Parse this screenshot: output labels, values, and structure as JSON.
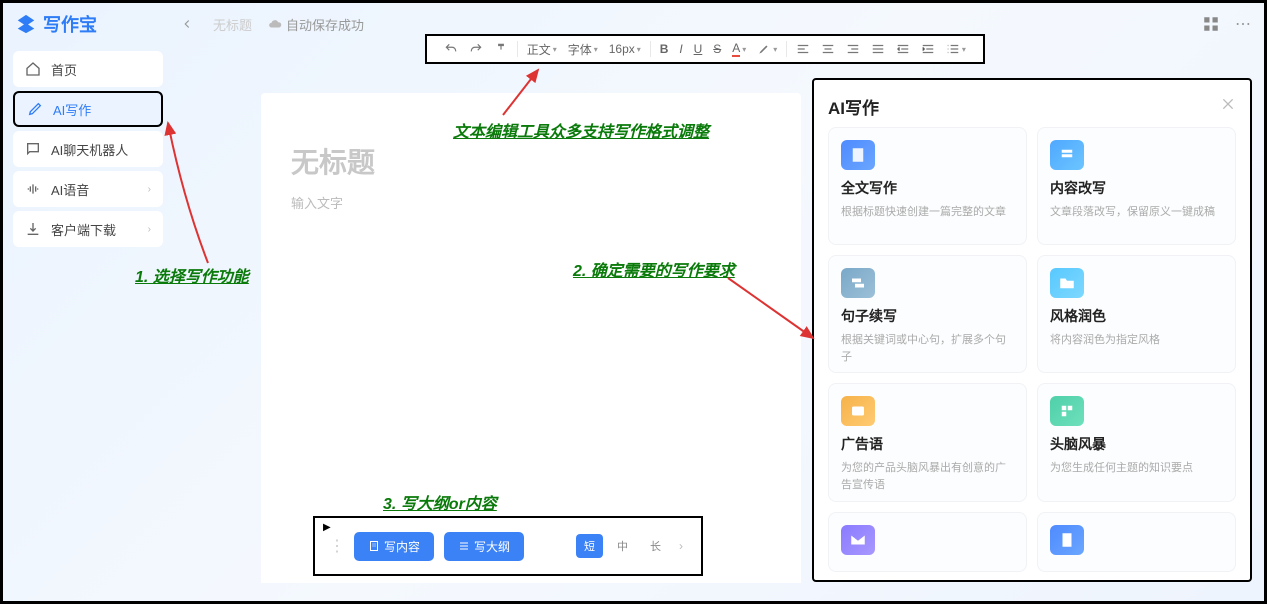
{
  "app": {
    "name": "写作宝"
  },
  "topbar": {
    "untitled": "无标题",
    "autosave": "自动保存成功"
  },
  "sidebar": {
    "items": [
      {
        "label": "首页"
      },
      {
        "label": "AI写作"
      },
      {
        "label": "AI聊天机器人"
      },
      {
        "label": "AI语音"
      },
      {
        "label": "客户端下载"
      }
    ]
  },
  "toolbar": {
    "align": "正文",
    "font": "字体",
    "size": "16px"
  },
  "document": {
    "title_placeholder": "无标题",
    "body_placeholder": "输入文字"
  },
  "bottom": {
    "write_content": "写内容",
    "write_outline": "写大纲",
    "length": {
      "short": "短",
      "medium": "中",
      "long": "长"
    }
  },
  "ai_panel": {
    "title": "AI写作",
    "cards": [
      {
        "title": "全文写作",
        "desc": "根据标题快速创建一篇完整的文章",
        "color": "#4f8bff"
      },
      {
        "title": "内容改写",
        "desc": "文章段落改写，保留原义一键成稿",
        "color": "#4fa8ff"
      },
      {
        "title": "句子续写",
        "desc": "根据关键词或中心句，扩展多个句子",
        "color": "#7aa8c8"
      },
      {
        "title": "风格润色",
        "desc": "将内容润色为指定风格",
        "color": "#58c8ff"
      },
      {
        "title": "广告语",
        "desc": "为您的产品头脑风暴出有创意的广告宣传语",
        "color": "#f6b24a"
      },
      {
        "title": "头脑风暴",
        "desc": "为您生成任何主题的知识要点",
        "color": "#4fd0a8"
      },
      {
        "title": "",
        "desc": "",
        "color": "#8a7bff"
      },
      {
        "title": "",
        "desc": "",
        "color": "#4f8bff"
      }
    ]
  },
  "annotations": {
    "a1": "1. 选择写作功能",
    "a2": "2. 确定需要的写作要求",
    "a3": "3. 写大纲or内容",
    "a_toolbar": "文本编辑工具众多支持写作格式调整"
  }
}
